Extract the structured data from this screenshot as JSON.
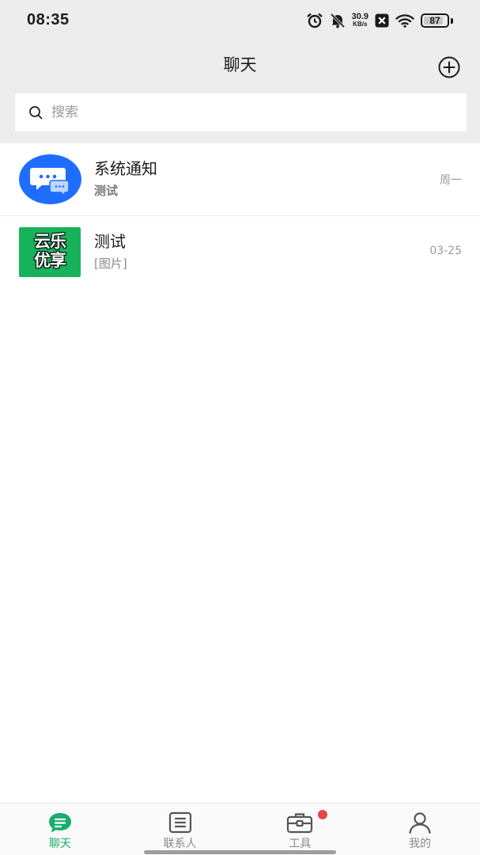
{
  "status_bar": {
    "time": "08:35",
    "net_speed_value": "30.9",
    "net_speed_unit": "KB/s",
    "battery": "87",
    "icons": [
      "alarm-icon",
      "mute-icon",
      "net-speed-text",
      "close-box-icon",
      "wifi-icon",
      "battery-icon"
    ]
  },
  "header": {
    "title": "聊天",
    "add_icon": "plus-circle-icon"
  },
  "search": {
    "placeholder": "搜索",
    "value": ""
  },
  "chats": [
    {
      "name": "系统通知",
      "preview": "测试",
      "time": "周一",
      "avatar": "message-bubble-icon"
    },
    {
      "name": "测试",
      "preview": "[图片]",
      "time": "03-25",
      "avatar": "app-logo"
    }
  ],
  "app_logo_text": {
    "line1": "云乐",
    "line2": "优享"
  },
  "tabs": [
    {
      "label": "聊天",
      "icon": "chat-bubble-icon",
      "active": true
    },
    {
      "label": "联系人",
      "icon": "contacts-list-icon",
      "active": false
    },
    {
      "label": "工具",
      "icon": "toolbox-icon",
      "active": false,
      "badge": true
    },
    {
      "label": "我的",
      "icon": "person-icon",
      "active": false
    }
  ],
  "colors": {
    "accent": "#1aad6a",
    "avatar_blue": "#1f6dfc",
    "logo_green": "#17b35b",
    "badge_red": "#e5454a",
    "header_bg": "#ededed"
  }
}
